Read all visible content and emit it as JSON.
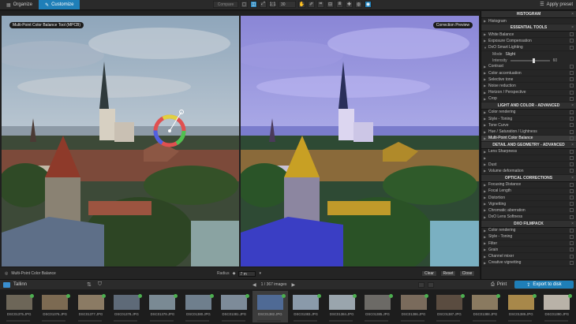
{
  "topbar": {
    "tabs": [
      {
        "label": "Organize"
      },
      {
        "label": "Customize"
      }
    ],
    "compare_label": "Compare",
    "zoom_ratio": "1:1",
    "zoom_select": "30",
    "apply_preset": "Apply preset"
  },
  "viewer": {
    "left_label": "Multi-Point Color Balance Tool (MPCB)",
    "right_label": "Correction Preview",
    "tool_name": "Multi-Point Color Balance",
    "radius_label": "Radius",
    "radius_value": "7 m",
    "buttons": {
      "clear": "Clear",
      "reset": "Reset",
      "close": "Close"
    }
  },
  "panel": {
    "histogram": {
      "title": "HISTOGRAM",
      "row": "Histogram"
    },
    "essential": {
      "title": "ESSENTIAL TOOLS",
      "rows": [
        "White Balance",
        "Exposure Compensation",
        "DxO Smart Lighting"
      ],
      "mode_label": "Mode",
      "mode_value": "Slight",
      "intensity_label": "Intensity",
      "intensity_value": "60",
      "rows2": [
        "Contrast",
        "Color accentuation",
        "Selective tone",
        "Noise reduction",
        "Horizon / Perspective",
        "Crop"
      ]
    },
    "light_color": {
      "title": "LIGHT AND COLOR - ADVANCED",
      "rows": [
        "Color rendering",
        "Style - Toning",
        "Tone Curve",
        "Hue / Saturation / Lightness",
        "Multi-Point Color Balance"
      ]
    },
    "detail": {
      "title": "DETAIL AND GEOMETRY - ADVANCED",
      "rows": [
        "Lens Sharpness",
        "",
        "Dust",
        "Volume deformation"
      ]
    },
    "optical": {
      "title": "OPTICAL CORRECTIONS",
      "rows": [
        "Focusing Distance",
        "Focal Length",
        "Distortion",
        "Vignetting",
        "Chromatic aberration",
        "DxO Lens Softness"
      ]
    },
    "filmpack": {
      "title": "DXO FILMPACK",
      "rows": [
        "Color rendering",
        "Style - Toning",
        "Filter",
        "Grain",
        "Channel mixer",
        "Creative vignetting"
      ]
    }
  },
  "filmbar": {
    "folder": "Tallinn",
    "count": "1 / 367 images",
    "print": "Print",
    "export": "Export to disk"
  },
  "filmstrip": [
    {
      "name": "DSC01375.JPG",
      "color": "#6d6658"
    },
    {
      "name": "DSC01376.JPG",
      "color": "#7c6a52"
    },
    {
      "name": "DSC01377.JPG",
      "color": "#8b7b64"
    },
    {
      "name": "DSC01378.JPG",
      "color": "#5e6a78"
    },
    {
      "name": "DSC01379.JPG",
      "color": "#7a8a94"
    },
    {
      "name": "DSC01380.JPG",
      "color": "#6f7f8d"
    },
    {
      "name": "DSC01381.JPG",
      "color": "#7d8b99"
    },
    {
      "name": "DSC01382.JPG",
      "color": "#4f6a95"
    },
    {
      "name": "DSC01383.JPG",
      "color": "#8a9aaa"
    },
    {
      "name": "DSC01384.JPG",
      "color": "#9aa5ad"
    },
    {
      "name": "DSC01385.JPG",
      "color": "#6c6a66"
    },
    {
      "name": "DSC01386.JPG",
      "color": "#7a6b5c"
    },
    {
      "name": "DSC01387.JPG",
      "color": "#5a4c40"
    },
    {
      "name": "DSC01388.JPG",
      "color": "#8a7a60"
    },
    {
      "name": "DSC01389.JPG",
      "color": "#a8884a"
    },
    {
      "name": "DSC01390.JPG",
      "color": "#b9b2a8"
    }
  ]
}
